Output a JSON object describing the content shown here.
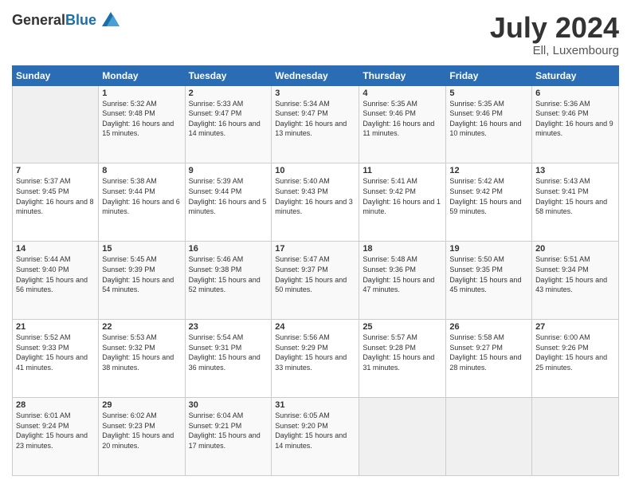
{
  "header": {
    "logo": {
      "text_general": "General",
      "text_blue": "Blue"
    },
    "title": "July 2024",
    "location": "Ell, Luxembourg"
  },
  "days_of_week": [
    "Sunday",
    "Monday",
    "Tuesday",
    "Wednesday",
    "Thursday",
    "Friday",
    "Saturday"
  ],
  "weeks": [
    [
      {
        "day": "",
        "sunrise": "",
        "sunset": "",
        "daylight": ""
      },
      {
        "day": "1",
        "sunrise": "Sunrise: 5:32 AM",
        "sunset": "Sunset: 9:48 PM",
        "daylight": "Daylight: 16 hours and 15 minutes."
      },
      {
        "day": "2",
        "sunrise": "Sunrise: 5:33 AM",
        "sunset": "Sunset: 9:47 PM",
        "daylight": "Daylight: 16 hours and 14 minutes."
      },
      {
        "day": "3",
        "sunrise": "Sunrise: 5:34 AM",
        "sunset": "Sunset: 9:47 PM",
        "daylight": "Daylight: 16 hours and 13 minutes."
      },
      {
        "day": "4",
        "sunrise": "Sunrise: 5:35 AM",
        "sunset": "Sunset: 9:46 PM",
        "daylight": "Daylight: 16 hours and 11 minutes."
      },
      {
        "day": "5",
        "sunrise": "Sunrise: 5:35 AM",
        "sunset": "Sunset: 9:46 PM",
        "daylight": "Daylight: 16 hours and 10 minutes."
      },
      {
        "day": "6",
        "sunrise": "Sunrise: 5:36 AM",
        "sunset": "Sunset: 9:46 PM",
        "daylight": "Daylight: 16 hours and 9 minutes."
      }
    ],
    [
      {
        "day": "7",
        "sunrise": "Sunrise: 5:37 AM",
        "sunset": "Sunset: 9:45 PM",
        "daylight": "Daylight: 16 hours and 8 minutes."
      },
      {
        "day": "8",
        "sunrise": "Sunrise: 5:38 AM",
        "sunset": "Sunset: 9:44 PM",
        "daylight": "Daylight: 16 hours and 6 minutes."
      },
      {
        "day": "9",
        "sunrise": "Sunrise: 5:39 AM",
        "sunset": "Sunset: 9:44 PM",
        "daylight": "Daylight: 16 hours and 5 minutes."
      },
      {
        "day": "10",
        "sunrise": "Sunrise: 5:40 AM",
        "sunset": "Sunset: 9:43 PM",
        "daylight": "Daylight: 16 hours and 3 minutes."
      },
      {
        "day": "11",
        "sunrise": "Sunrise: 5:41 AM",
        "sunset": "Sunset: 9:42 PM",
        "daylight": "Daylight: 16 hours and 1 minute."
      },
      {
        "day": "12",
        "sunrise": "Sunrise: 5:42 AM",
        "sunset": "Sunset: 9:42 PM",
        "daylight": "Daylight: 15 hours and 59 minutes."
      },
      {
        "day": "13",
        "sunrise": "Sunrise: 5:43 AM",
        "sunset": "Sunset: 9:41 PM",
        "daylight": "Daylight: 15 hours and 58 minutes."
      }
    ],
    [
      {
        "day": "14",
        "sunrise": "Sunrise: 5:44 AM",
        "sunset": "Sunset: 9:40 PM",
        "daylight": "Daylight: 15 hours and 56 minutes."
      },
      {
        "day": "15",
        "sunrise": "Sunrise: 5:45 AM",
        "sunset": "Sunset: 9:39 PM",
        "daylight": "Daylight: 15 hours and 54 minutes."
      },
      {
        "day": "16",
        "sunrise": "Sunrise: 5:46 AM",
        "sunset": "Sunset: 9:38 PM",
        "daylight": "Daylight: 15 hours and 52 minutes."
      },
      {
        "day": "17",
        "sunrise": "Sunrise: 5:47 AM",
        "sunset": "Sunset: 9:37 PM",
        "daylight": "Daylight: 15 hours and 50 minutes."
      },
      {
        "day": "18",
        "sunrise": "Sunrise: 5:48 AM",
        "sunset": "Sunset: 9:36 PM",
        "daylight": "Daylight: 15 hours and 47 minutes."
      },
      {
        "day": "19",
        "sunrise": "Sunrise: 5:50 AM",
        "sunset": "Sunset: 9:35 PM",
        "daylight": "Daylight: 15 hours and 45 minutes."
      },
      {
        "day": "20",
        "sunrise": "Sunrise: 5:51 AM",
        "sunset": "Sunset: 9:34 PM",
        "daylight": "Daylight: 15 hours and 43 minutes."
      }
    ],
    [
      {
        "day": "21",
        "sunrise": "Sunrise: 5:52 AM",
        "sunset": "Sunset: 9:33 PM",
        "daylight": "Daylight: 15 hours and 41 minutes."
      },
      {
        "day": "22",
        "sunrise": "Sunrise: 5:53 AM",
        "sunset": "Sunset: 9:32 PM",
        "daylight": "Daylight: 15 hours and 38 minutes."
      },
      {
        "day": "23",
        "sunrise": "Sunrise: 5:54 AM",
        "sunset": "Sunset: 9:31 PM",
        "daylight": "Daylight: 15 hours and 36 minutes."
      },
      {
        "day": "24",
        "sunrise": "Sunrise: 5:56 AM",
        "sunset": "Sunset: 9:29 PM",
        "daylight": "Daylight: 15 hours and 33 minutes."
      },
      {
        "day": "25",
        "sunrise": "Sunrise: 5:57 AM",
        "sunset": "Sunset: 9:28 PM",
        "daylight": "Daylight: 15 hours and 31 minutes."
      },
      {
        "day": "26",
        "sunrise": "Sunrise: 5:58 AM",
        "sunset": "Sunset: 9:27 PM",
        "daylight": "Daylight: 15 hours and 28 minutes."
      },
      {
        "day": "27",
        "sunrise": "Sunrise: 6:00 AM",
        "sunset": "Sunset: 9:26 PM",
        "daylight": "Daylight: 15 hours and 25 minutes."
      }
    ],
    [
      {
        "day": "28",
        "sunrise": "Sunrise: 6:01 AM",
        "sunset": "Sunset: 9:24 PM",
        "daylight": "Daylight: 15 hours and 23 minutes."
      },
      {
        "day": "29",
        "sunrise": "Sunrise: 6:02 AM",
        "sunset": "Sunset: 9:23 PM",
        "daylight": "Daylight: 15 hours and 20 minutes."
      },
      {
        "day": "30",
        "sunrise": "Sunrise: 6:04 AM",
        "sunset": "Sunset: 9:21 PM",
        "daylight": "Daylight: 15 hours and 17 minutes."
      },
      {
        "day": "31",
        "sunrise": "Sunrise: 6:05 AM",
        "sunset": "Sunset: 9:20 PM",
        "daylight": "Daylight: 15 hours and 14 minutes."
      },
      {
        "day": "",
        "sunrise": "",
        "sunset": "",
        "daylight": ""
      },
      {
        "day": "",
        "sunrise": "",
        "sunset": "",
        "daylight": ""
      },
      {
        "day": "",
        "sunrise": "",
        "sunset": "",
        "daylight": ""
      }
    ]
  ]
}
